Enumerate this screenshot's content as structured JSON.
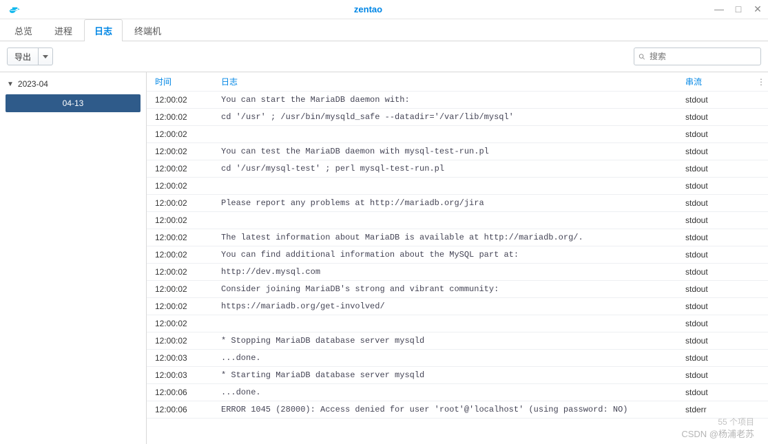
{
  "window": {
    "title": "zentao"
  },
  "tabs": {
    "items": [
      {
        "label": "总览",
        "active": false
      },
      {
        "label": "进程",
        "active": false
      },
      {
        "label": "日志",
        "active": true
      },
      {
        "label": "终端机",
        "active": false
      }
    ]
  },
  "toolbar": {
    "export_label": "导出",
    "search_placeholder": "搜索"
  },
  "sidebar": {
    "group_label": "2023-04",
    "selected_day": "04-13"
  },
  "table": {
    "headers": {
      "time": "时间",
      "log": "日志",
      "stream": "串流"
    },
    "rows": [
      {
        "time": "12:00:02",
        "log": "You can start the MariaDB daemon with:",
        "stream": "stdout"
      },
      {
        "time": "12:00:02",
        "log": "cd '/usr' ; /usr/bin/mysqld_safe --datadir='/var/lib/mysql'",
        "stream": "stdout"
      },
      {
        "time": "12:00:02",
        "log": "",
        "stream": "stdout"
      },
      {
        "time": "12:00:02",
        "log": "You can test the MariaDB daemon with mysql-test-run.pl",
        "stream": "stdout"
      },
      {
        "time": "12:00:02",
        "log": "cd '/usr/mysql-test' ; perl mysql-test-run.pl",
        "stream": "stdout"
      },
      {
        "time": "12:00:02",
        "log": "",
        "stream": "stdout"
      },
      {
        "time": "12:00:02",
        "log": "Please report any problems at http://mariadb.org/jira",
        "stream": "stdout"
      },
      {
        "time": "12:00:02",
        "log": "",
        "stream": "stdout"
      },
      {
        "time": "12:00:02",
        "log": "The latest information about MariaDB is available at http://mariadb.org/.",
        "stream": "stdout"
      },
      {
        "time": "12:00:02",
        "log": "You can find additional information about the MySQL part at:",
        "stream": "stdout"
      },
      {
        "time": "12:00:02",
        "log": "http://dev.mysql.com",
        "stream": "stdout"
      },
      {
        "time": "12:00:02",
        "log": "Consider joining MariaDB's strong and vibrant community:",
        "stream": "stdout"
      },
      {
        "time": "12:00:02",
        "log": "https://mariadb.org/get-involved/",
        "stream": "stdout"
      },
      {
        "time": "12:00:02",
        "log": "",
        "stream": "stdout"
      },
      {
        "time": "12:00:02",
        "log": " * Stopping MariaDB database server mysqld",
        "stream": "stdout"
      },
      {
        "time": "12:00:03",
        "log": "   ...done.",
        "stream": "stdout"
      },
      {
        "time": "12:00:03",
        "log": " * Starting MariaDB database server mysqld",
        "stream": "stdout"
      },
      {
        "time": "12:00:06",
        "log": "   ...done.",
        "stream": "stdout"
      },
      {
        "time": "12:00:06",
        "log": "ERROR 1045 (28000): Access denied for user 'root'@'localhost' (using password: NO)",
        "stream": "stderr"
      }
    ]
  },
  "footer": {
    "count_text": "55 个项目"
  },
  "watermark": "CSDN @杨浦老苏"
}
